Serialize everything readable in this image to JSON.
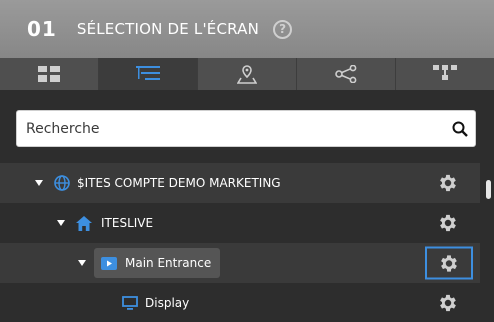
{
  "header": {
    "step_number": "01",
    "title": "SÉLECTION DE L'ÉCRAN",
    "help_label": "?"
  },
  "tabs": [
    {
      "icon": "grid-icon",
      "active": false
    },
    {
      "icon": "tree-list-icon",
      "active": true
    },
    {
      "icon": "map-pin-icon",
      "active": false
    },
    {
      "icon": "share-nodes-icon",
      "active": false
    },
    {
      "icon": "hierarchy-icon",
      "active": false
    }
  ],
  "search": {
    "placeholder": "Recherche",
    "value": ""
  },
  "tree": {
    "items": [
      {
        "label": "$ITES COMPTE DEMO MARKETING",
        "icon": "globe-icon",
        "expanded": true
      },
      {
        "label": "ITESLIVE",
        "icon": "home-icon",
        "expanded": true
      },
      {
        "label": "Main Entrance",
        "icon": "play-screen-icon",
        "expanded": true,
        "highlighted": true
      },
      {
        "label": "Display",
        "icon": "monitor-icon",
        "expanded": false
      }
    ]
  },
  "colors": {
    "accent": "#3d8fe0",
    "header_bg": "#8f8f8f",
    "panel_bg": "#2d2d2d",
    "row_alt_bg": "#3a3a3a"
  }
}
